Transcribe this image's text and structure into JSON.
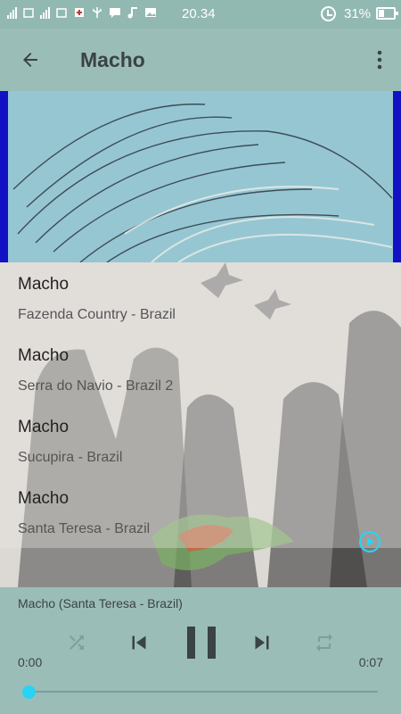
{
  "status_bar": {
    "time": "20.34",
    "battery": "31%",
    "icons": [
      "signal-icon",
      "signal-icon",
      "mail-icon",
      "usb-icon",
      "chat-icon",
      "music-note-icon",
      "image-icon",
      "alarm-icon",
      "battery-icon"
    ]
  },
  "appbar": {
    "title": "Macho",
    "back_icon": "arrow-back-icon",
    "menu_icon": "more-vert-icon"
  },
  "tracks": [
    {
      "title": "Macho",
      "subtitle": "Fazenda Country - Brazil",
      "playing": false
    },
    {
      "title": "Macho",
      "subtitle": "Serra do Navio - Brazil 2",
      "playing": false
    },
    {
      "title": "Macho",
      "subtitle": "Sucupira - Brazil",
      "playing": false
    },
    {
      "title": "Macho",
      "subtitle": "Santa Teresa - Brazil",
      "playing": true
    }
  ],
  "player": {
    "now_playing": "Macho (Santa Teresa - Brazil)",
    "elapsed": "0:00",
    "duration": "0:07",
    "progress": 0.0,
    "controls": [
      "shuffle-icon",
      "skip-previous-icon",
      "pause-icon",
      "skip-next-icon",
      "repeat-icon"
    ]
  },
  "colors": {
    "bar_bg": "#9bbdb8",
    "accent": "#28d3f5",
    "text_dark": "#3a4346"
  }
}
